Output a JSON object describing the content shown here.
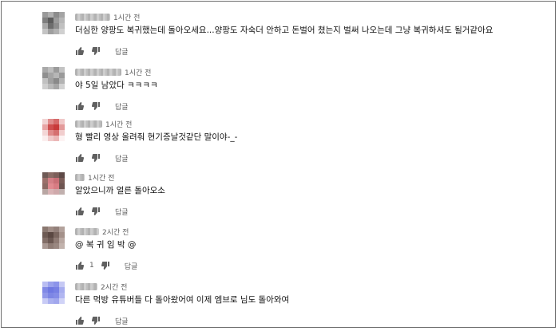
{
  "comments": [
    {
      "author": "●●●●",
      "time": "1시간 전",
      "text": "더심한 양팡도 복귀했는데 돌아오세요...양팡도 자숙더 안하고 돈벌어 쳤는지 벌써 나오는데 그냥 복귀하셔도 될거같아요",
      "likes": "",
      "reply_label": "답글",
      "avatar_colors": [
        "#9a9a9a",
        "#b0b0b0",
        "#8c8c8c",
        "#a4a4a4",
        "#7f7f7f",
        "#5c5c5c",
        "#9b9b9b",
        "#b6b6b6",
        "#a8a8a8",
        "#6d6d6d",
        "#8e8e8e",
        "#c0c0c0",
        "#c4c4c4",
        "#9f9f9f",
        "#b1b1b1",
        "#d0d0d0"
      ]
    },
    {
      "author": "●●●●",
      "time": "1시간 전",
      "text": "야 5일 남았다 ㅋㅋㅋㅋ",
      "likes": "",
      "reply_label": "답글",
      "avatar_colors": [
        "#a9a9a9",
        "#bdbdbd",
        "#9b9b9b",
        "#c3c3c3",
        "#8f8f8f",
        "#a5a5a5",
        "#b6b6b6",
        "#9a9a9a",
        "#c1c1c1",
        "#a0a0a0",
        "#8a8a8a",
        "#b3b3b3",
        "#cfcfcf",
        "#b9b9b9",
        "#a6a6a6",
        "#d2d2d2"
      ]
    },
    {
      "author": "●●●●",
      "time": "1시간 전",
      "text": "형 빨리 영상 올려줘 현기증날것같단 말이야-_-",
      "likes": "",
      "reply_label": "답글",
      "avatar_colors": [
        "#f2d3d3",
        "#e08c8c",
        "#d66b6b",
        "#f0c8c8",
        "#e8a4a4",
        "#cf4f4f",
        "#c83a3a",
        "#e39a9a",
        "#f3d6d6",
        "#df8a8a",
        "#d57070",
        "#f1cdcd",
        "#fbeeee",
        "#f0caca",
        "#ebb7b7",
        "#fdf3f3"
      ]
    },
    {
      "author": "●●",
      "time": "1시간 전",
      "text": "알았으니까 얼른 돌아오소",
      "likes": "",
      "reply_label": "답글",
      "avatar_colors": [
        "#6f5a56",
        "#8a6c66",
        "#7c5f5a",
        "#5e4a47",
        "#9b6f6a",
        "#d47f86",
        "#c96f76",
        "#7b5d58",
        "#8d6a64",
        "#e08a90",
        "#d77c83",
        "#6e5551",
        "#b8a6a3",
        "#d9b3b5",
        "#cfa9ab",
        "#c1b0ae"
      ]
    },
    {
      "author": "●●●",
      "time": "2시간 전",
      "text": "@ 복 귀 임 박 @",
      "likes": "1",
      "reply_label": "답글",
      "avatar_colors": [
        "#8a7870",
        "#a08d86",
        "#93807a",
        "#b3a29c",
        "#6d5a53",
        "#5b4842",
        "#7a665f",
        "#a4918a",
        "#826e67",
        "#6b5852",
        "#8e7a73",
        "#b9a8a2",
        "#a99892",
        "#8f7c75",
        "#9a8881",
        "#c2b3ad"
      ]
    },
    {
      "author": "●●●",
      "time": "2시간 전",
      "text": "다른 먹방 유튜버들 다 돌아왔어여 이제 엠브로 님도 돌아와여",
      "likes": "",
      "reply_label": "답글",
      "avatar_colors": [
        "#b9bdf2",
        "#9aa1ec",
        "#8c94ea",
        "#c6c9f4",
        "#8189e6",
        "#6f78e2",
        "#7780e4",
        "#a7adef",
        "#9198ea",
        "#7d86e5",
        "#848ce7",
        "#b1b6f1",
        "#c8cbf5",
        "#aab0ef",
        "#a1a7ed",
        "#d0d3f7"
      ]
    }
  ]
}
